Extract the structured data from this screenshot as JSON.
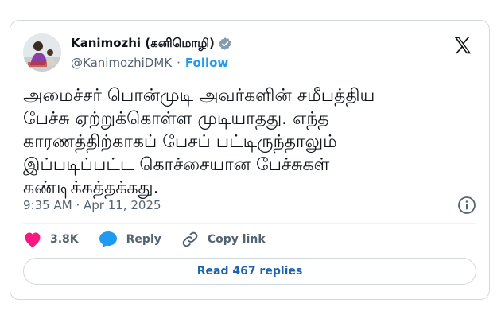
{
  "author": {
    "display_name": "Kanimozhi (கனிமொழி)",
    "handle": "@KanimozhiDMK",
    "follow_label": "Follow"
  },
  "tweet": {
    "text": "அமைச்சர் பொன்முடி அவர்களின் சமீபத்திய\nபேச்சு ஏற்றுக்கொள்ள முடியாதது. எந்த\nகாரணத்திற்காகப் பேசப் பட்டிருந்தாலும்\nஇப்படிப்பட்ட கொச்சையான பேச்சுகள்\nகண்டிக்கத்தக்கது.",
    "time": "9:35 AM",
    "date": "Apr 11, 2025"
  },
  "actions": {
    "like_count": "3.8K",
    "reply_label": "Reply",
    "copy_link_label": "Copy link"
  },
  "read_replies_label": "Read 467 replies",
  "icons": [
    "verified-badge-icon",
    "x-logo-icon",
    "info-icon",
    "heart-icon",
    "reply-bubble-icon",
    "link-icon"
  ],
  "colors": {
    "accent": "#1d9bf0",
    "like": "#f91880",
    "text": "#0f1419",
    "muted": "#536471",
    "border": "#cfd9de"
  }
}
